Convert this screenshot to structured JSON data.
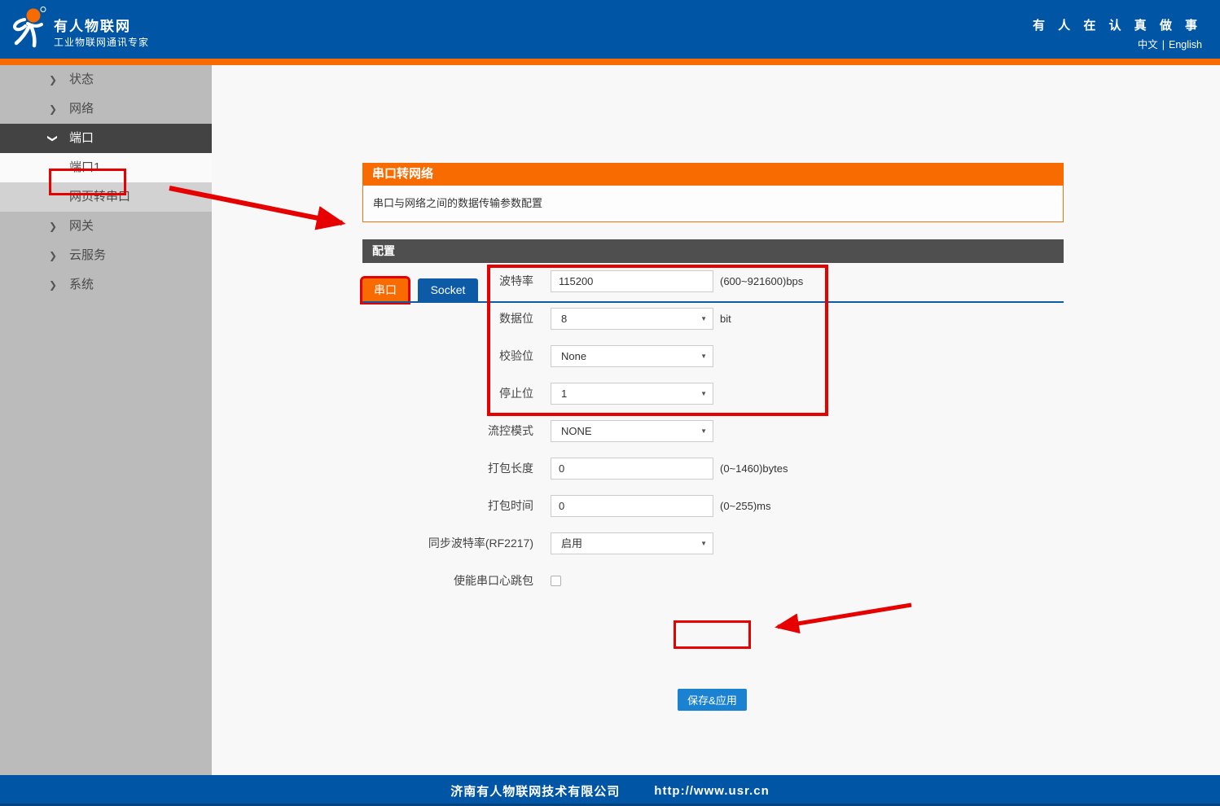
{
  "header": {
    "brand_title": "有人物联网",
    "brand_subtitle": "工业物联网通讯专家",
    "slogan": "有 人 在 认 真 做 事",
    "lang_zh": "中文",
    "lang_sep": "|",
    "lang_en": "English"
  },
  "sidebar": {
    "items": [
      {
        "id": "status",
        "label": "状态",
        "chevron": "right",
        "type": "group"
      },
      {
        "id": "network",
        "label": "网络",
        "chevron": "right",
        "type": "group"
      },
      {
        "id": "port",
        "label": "端口",
        "chevron": "down",
        "type": "group",
        "active": true
      },
      {
        "id": "port1",
        "label": "端口1",
        "type": "sub",
        "selected": true
      },
      {
        "id": "web2serial",
        "label": "网页转串口",
        "type": "sub"
      },
      {
        "id": "gateway",
        "label": "网关",
        "chevron": "right",
        "type": "group"
      },
      {
        "id": "cloud",
        "label": "云服务",
        "chevron": "right",
        "type": "group"
      },
      {
        "id": "system",
        "label": "系统",
        "chevron": "right",
        "type": "group"
      }
    ]
  },
  "main": {
    "banner_title": "串口转网络",
    "banner_desc": "串口与网络之间的数据传输参数配置",
    "section_title": "配置",
    "tabs": {
      "serial": "串口",
      "socket": "Socket"
    },
    "form": {
      "rows": [
        {
          "id": "baud-rate",
          "label": "波特率",
          "control": "input",
          "value": "115200",
          "hint": "(600~921600)bps"
        },
        {
          "id": "data-bits",
          "label": "数据位",
          "control": "select",
          "value": "8",
          "hint": "bit"
        },
        {
          "id": "parity",
          "label": "校验位",
          "control": "select",
          "value": "None",
          "hint": ""
        },
        {
          "id": "stop-bits",
          "label": "停止位",
          "control": "select",
          "value": "1",
          "hint": ""
        },
        {
          "id": "flow-control",
          "label": "流控模式",
          "control": "select",
          "value": "NONE",
          "hint": ""
        },
        {
          "id": "pack-length",
          "label": "打包长度",
          "control": "input",
          "value": "0",
          "hint": "(0~1460)bytes"
        },
        {
          "id": "pack-time",
          "label": "打包时间",
          "control": "input",
          "value": "0",
          "hint": "(0~255)ms"
        },
        {
          "id": "sync-baud",
          "label": "同步波特率(RF2217)",
          "control": "select",
          "value": "启用",
          "hint": ""
        },
        {
          "id": "heartbeat",
          "label": "使能串口心跳包",
          "control": "checkbox",
          "checked": false,
          "hint": ""
        }
      ],
      "save_label": "保存&应用"
    }
  },
  "footer": {
    "company": "济南有人物联网技术有限公司",
    "url": "http://www.usr.cn"
  },
  "colors": {
    "brand_blue": "#0055a5",
    "brand_orange": "#f76b01",
    "socket_tab_blue": "#0d5ba6",
    "section_bar_gray": "#4f4f4f",
    "save_button_blue": "#1b82d2",
    "annotation_red": "#e60000",
    "sidebar_gray": "#bbbbbb"
  }
}
